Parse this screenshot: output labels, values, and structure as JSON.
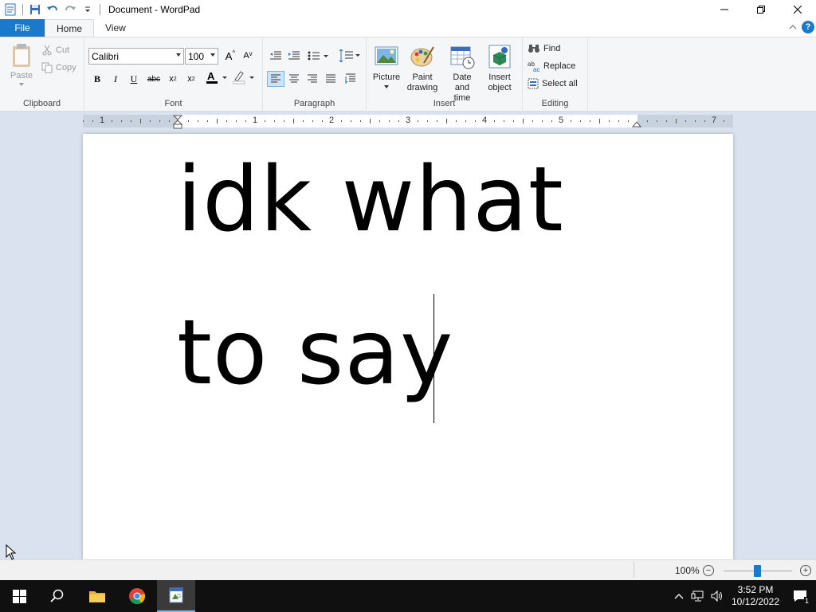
{
  "window": {
    "title": "Document - WordPad"
  },
  "ribbon_tabs": {
    "file": "File",
    "home": "Home",
    "view": "View"
  },
  "clipboard": {
    "paste": "Paste",
    "cut": "Cut",
    "copy": "Copy",
    "label": "Clipboard"
  },
  "font": {
    "family": "Calibri",
    "size": "100",
    "label": "Font"
  },
  "paragraph": {
    "label": "Paragraph"
  },
  "insert": {
    "picture": "Picture",
    "paint_line1": "Paint",
    "paint_line2": "drawing",
    "datetime_line1": "Date and",
    "datetime_line2": "time",
    "object_line1": "Insert",
    "object_line2": "object",
    "label": "Insert"
  },
  "editing": {
    "find": "Find",
    "replace": "Replace",
    "select_all": "Select all",
    "label": "Editing"
  },
  "ruler": {
    "numbers": [
      "1",
      "1",
      "2",
      "3",
      "4",
      "5",
      "7"
    ]
  },
  "document": {
    "line1": "idk what",
    "line2": "to say"
  },
  "status": {
    "zoom": "100%"
  },
  "taskbar": {
    "time": "3:52 PM",
    "date": "10/12/2022",
    "notification_count": "1"
  },
  "colors": {
    "accent": "#1979ca",
    "ribbon_bg": "#f5f6f7",
    "workspace": "#d9e2ee",
    "taskbar": "#101010"
  }
}
